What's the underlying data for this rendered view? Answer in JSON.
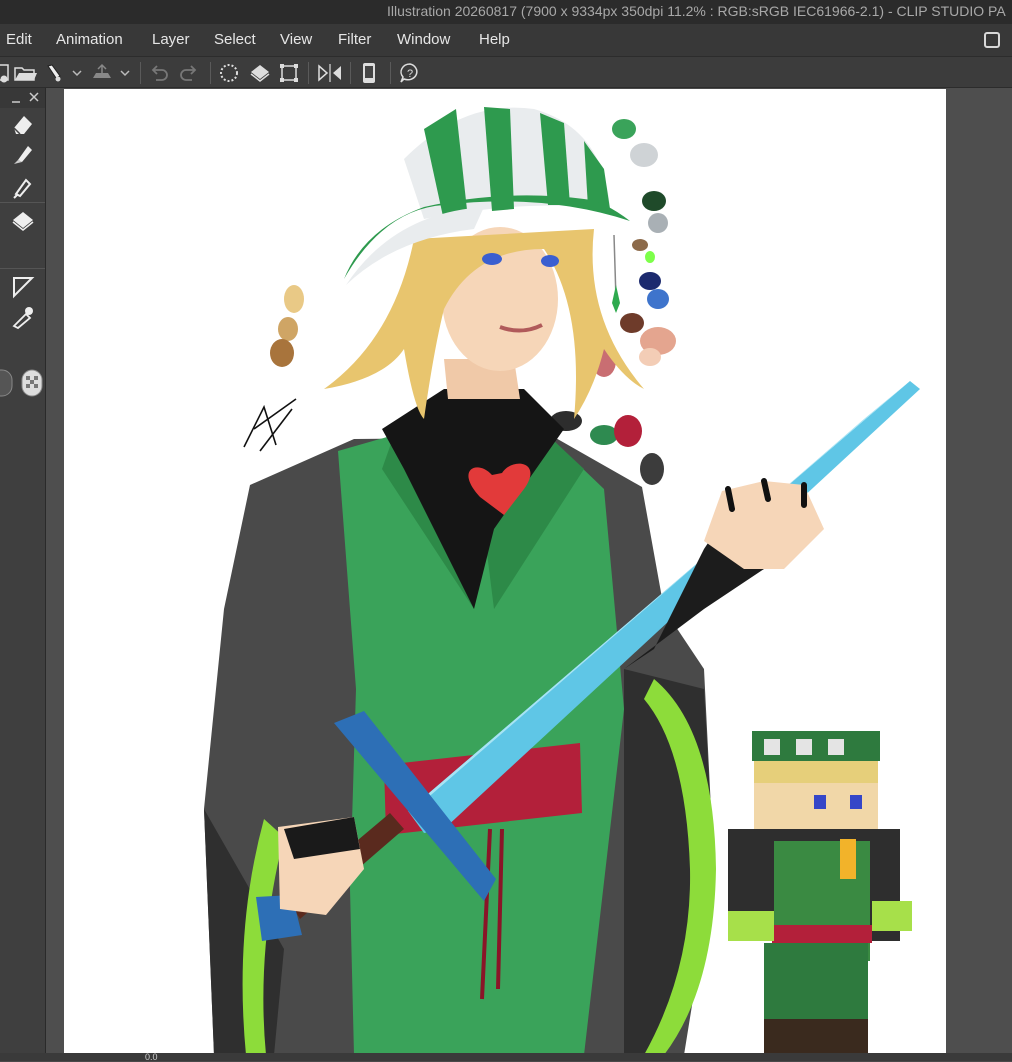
{
  "window": {
    "title": "Illustration 20260817 (7900 x 9334px 350dpi 11.2% : RGB:sRGB IEC61966-2.1)  - CLIP STUDIO PA"
  },
  "menu": {
    "items": [
      "Edit",
      "Animation",
      "Layer",
      "Select",
      "View",
      "Filter",
      "Window",
      "Help"
    ]
  },
  "command_bar": {
    "icons": [
      "new-file-icon",
      "open-folder-icon",
      "pen-dropdown-icon",
      "export-dropdown-icon",
      "undo-icon",
      "redo-icon",
      "clear-selection-icon",
      "fill-icon",
      "transform-icon",
      "flip-icon",
      "device-icon",
      "help-icon"
    ]
  },
  "tool_panel": {
    "icons": [
      "eraser-icon",
      "brush-icon",
      "pen-icon",
      "fill-bucket-icon",
      "shape-icon",
      "eyedropper-icon",
      "transparent-color-icon"
    ]
  },
  "status_bar": {
    "zoom": "0.0"
  },
  "colors": {
    "ui_dark": "#2b2b2b",
    "ui_panel": "#3f3f3f",
    "canvas": "#ffffff",
    "robe_green": "#3aa35a",
    "sword_blue": "#5fc6e6",
    "sash_red": "#b3203a"
  }
}
